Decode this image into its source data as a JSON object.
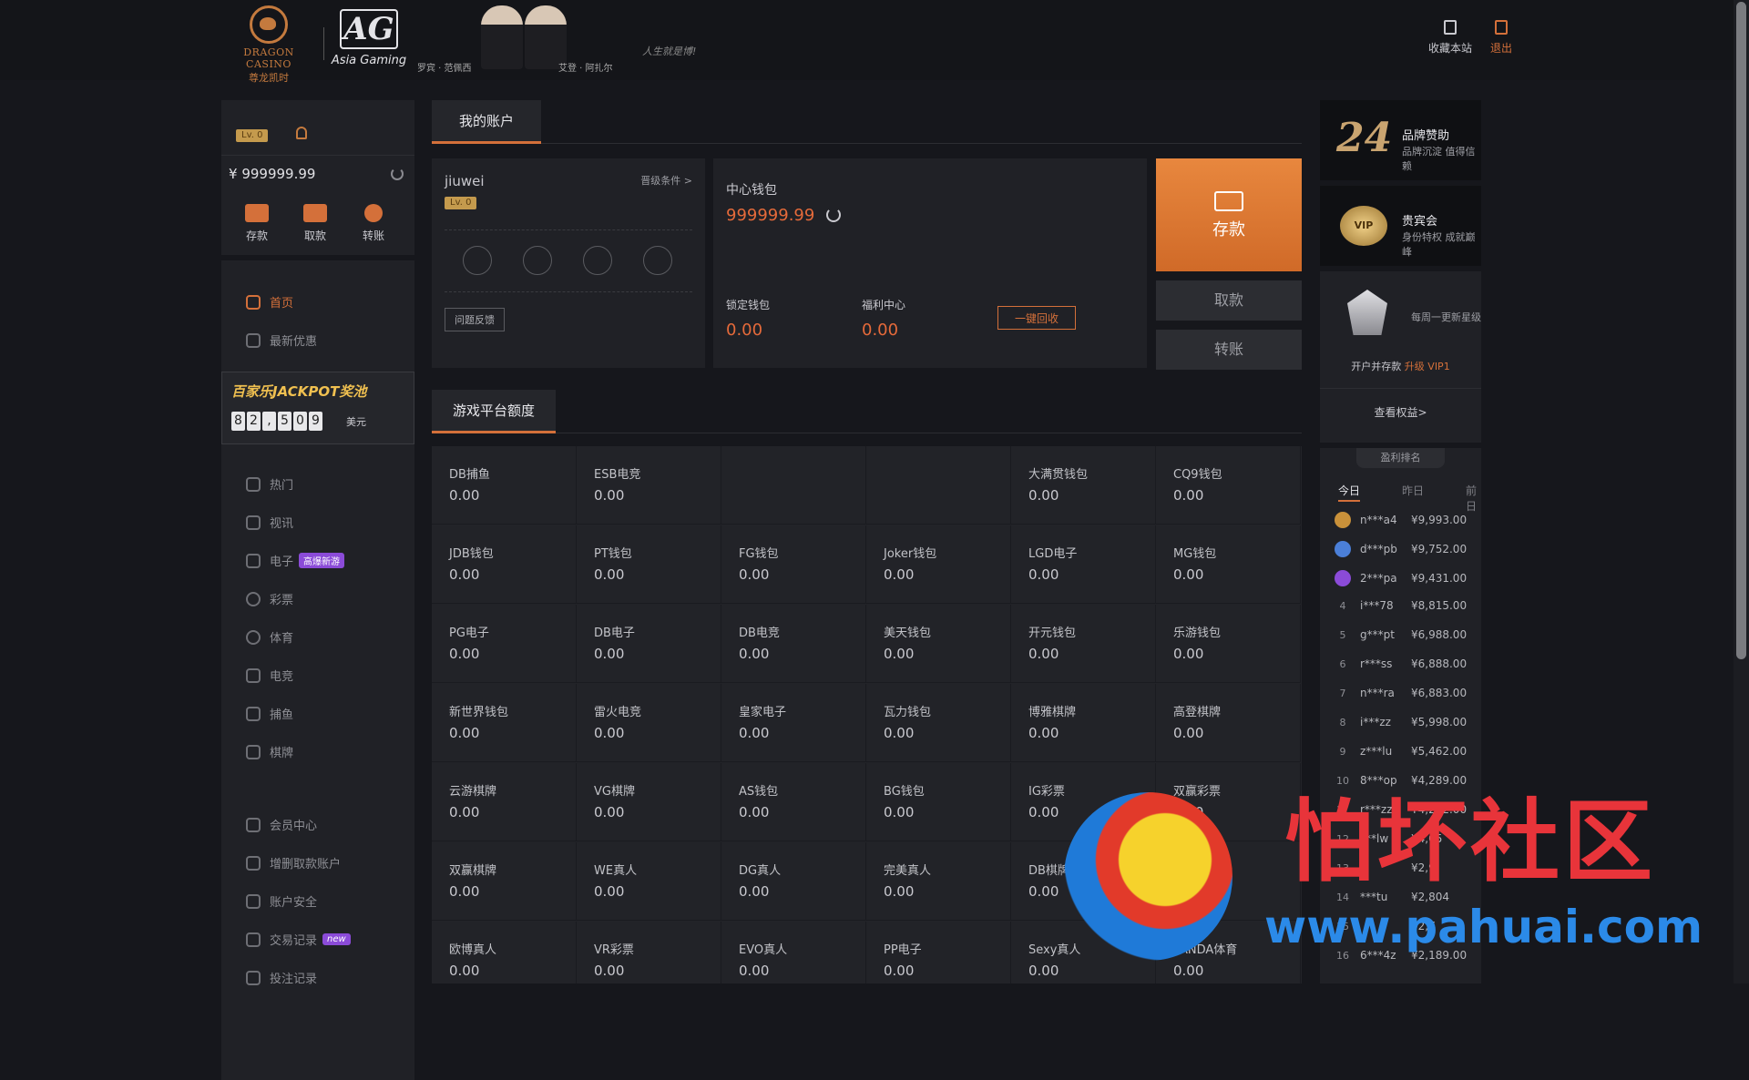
{
  "header": {
    "logo": {
      "en": "DRAGON CASINO",
      "cn": "尊龙凯时"
    },
    "partner": {
      "big": "AG",
      "small": "Asia Gaming"
    },
    "ambassadors": [
      "罗宾 · 范佩西",
      "艾登 · 阿扎尔"
    ],
    "slogan": "人生就是博!",
    "bookmark_label": "收藏本站",
    "logout_label": "退出"
  },
  "sidebar": {
    "level": "Lv. 0",
    "balance": "999999.99",
    "actions": [
      {
        "label": "存款"
      },
      {
        "label": "取款"
      },
      {
        "label": "转账"
      }
    ],
    "main_nav": [
      {
        "label": "首页"
      },
      {
        "label": "最新优惠"
      }
    ],
    "jackpot": {
      "title": "百家乐JACKPOT奖池",
      "digits": [
        "8",
        "2",
        ",",
        "5",
        "0",
        "9"
      ],
      "unit": "美元"
    },
    "game_nav": [
      {
        "label": "热门"
      },
      {
        "label": "视讯"
      },
      {
        "label": "电子",
        "badge": "高爆新游"
      },
      {
        "label": "彩票"
      },
      {
        "label": "体育"
      },
      {
        "label": "电竞"
      },
      {
        "label": "捕鱼"
      },
      {
        "label": "棋牌"
      }
    ],
    "account_nav": [
      {
        "label": "会员中心"
      },
      {
        "label": "增删取款账户"
      },
      {
        "label": "账户安全"
      },
      {
        "label": "交易记录",
        "badge": "new"
      },
      {
        "label": "投注记录"
      }
    ]
  },
  "account": {
    "tab_label": "我的账户",
    "username": "jiuwei",
    "level": "Lv. 0",
    "upgrade_link": "晋级条件 >",
    "feedback_label": "问题反馈"
  },
  "wallet": {
    "center_label": "中心钱包",
    "center_amount": "999999.99",
    "locked_label": "锁定钱包",
    "locked_amount": "0.00",
    "welfare_label": "福利中心",
    "welfare_amount": "0.00",
    "recall_label": "一键回收"
  },
  "buttons": {
    "deposit": "存款",
    "withdraw": "取款",
    "transfer": "转账"
  },
  "platforms": {
    "tab_label": "游戏平台额度",
    "items": [
      {
        "name": "DB捕鱼",
        "value": "0.00"
      },
      {
        "name": "ESB电竞",
        "value": "0.00"
      },
      {
        "name": "",
        "value": ""
      },
      {
        "name": "",
        "value": ""
      },
      {
        "name": "大满贯钱包",
        "value": "0.00"
      },
      {
        "name": "CQ9钱包",
        "value": "0.00"
      },
      {
        "name": "JDB钱包",
        "value": "0.00"
      },
      {
        "name": "PT钱包",
        "value": "0.00"
      },
      {
        "name": "FG钱包",
        "value": "0.00"
      },
      {
        "name": "Joker钱包",
        "value": "0.00"
      },
      {
        "name": "LGD电子",
        "value": "0.00"
      },
      {
        "name": "MG钱包",
        "value": "0.00"
      },
      {
        "name": "PG电子",
        "value": "0.00"
      },
      {
        "name": "DB电子",
        "value": "0.00"
      },
      {
        "name": "DB电竞",
        "value": "0.00"
      },
      {
        "name": "美天钱包",
        "value": "0.00"
      },
      {
        "name": "开元钱包",
        "value": "0.00"
      },
      {
        "name": "乐游钱包",
        "value": "0.00"
      },
      {
        "name": "新世界钱包",
        "value": "0.00"
      },
      {
        "name": "雷火电竞",
        "value": "0.00"
      },
      {
        "name": "皇家电子",
        "value": "0.00"
      },
      {
        "name": "瓦力钱包",
        "value": "0.00"
      },
      {
        "name": "博雅棋牌",
        "value": "0.00"
      },
      {
        "name": "高登棋牌",
        "value": "0.00"
      },
      {
        "name": "云游棋牌",
        "value": "0.00"
      },
      {
        "name": "VG棋牌",
        "value": "0.00"
      },
      {
        "name": "AS钱包",
        "value": "0.00"
      },
      {
        "name": "BG钱包",
        "value": "0.00"
      },
      {
        "name": "IG彩票",
        "value": "0.00"
      },
      {
        "name": "双赢彩票",
        "value": "0.00"
      },
      {
        "name": "双赢棋牌",
        "value": "0.00"
      },
      {
        "name": "WE真人",
        "value": "0.00"
      },
      {
        "name": "DG真人",
        "value": "0.00"
      },
      {
        "name": "完美真人",
        "value": "0.00"
      },
      {
        "name": "DB棋牌",
        "value": "0.00"
      },
      {
        "name": "",
        "value": ""
      },
      {
        "name": "欧博真人",
        "value": "0.00"
      },
      {
        "name": "VR彩票",
        "value": "0.00"
      },
      {
        "name": "EVO真人",
        "value": "0.00"
      },
      {
        "name": "PP电子",
        "value": "0.00"
      },
      {
        "name": "Sexy真人",
        "value": "0.00"
      },
      {
        "name": "PANDA体育",
        "value": "0.00"
      }
    ]
  },
  "promos": [
    {
      "badge": "24",
      "title": "品牌赞助",
      "subtitle": "品牌沉淀 值得信赖"
    },
    {
      "badge": "VIP",
      "title": "贵宾会",
      "subtitle": "身份特权 成就巅峰"
    }
  ],
  "vip_card": {
    "weekly": "每周一更新星级",
    "open_text": "开户并存款",
    "upgrade": "升级 VIP1",
    "view_link": "查看权益>"
  },
  "ranking": {
    "title": "盈利排名",
    "tabs": [
      "今日",
      "昨日",
      "前日"
    ],
    "rows": [
      {
        "rank": "1",
        "user": "n***a4",
        "amount": "¥9,993.00"
      },
      {
        "rank": "2",
        "user": "d***pb",
        "amount": "¥9,752.00"
      },
      {
        "rank": "3",
        "user": "2***pa",
        "amount": "¥9,431.00"
      },
      {
        "rank": "4",
        "user": "i***78",
        "amount": "¥8,815.00"
      },
      {
        "rank": "5",
        "user": "g***pt",
        "amount": "¥6,988.00"
      },
      {
        "rank": "6",
        "user": "r***ss",
        "amount": "¥6,888.00"
      },
      {
        "rank": "7",
        "user": "n***ra",
        "amount": "¥6,883.00"
      },
      {
        "rank": "8",
        "user": "i***zz",
        "amount": "¥5,998.00"
      },
      {
        "rank": "9",
        "user": "z***lu",
        "amount": "¥5,462.00"
      },
      {
        "rank": "10",
        "user": "8***op",
        "amount": "¥4,289.00"
      },
      {
        "rank": "11",
        "user": "r***zz",
        "amount": "¥4,232.00"
      },
      {
        "rank": "12",
        "user": "***lw",
        "amount": "¥4,05"
      },
      {
        "rank": "13",
        "user": "",
        "amount": "¥2,9"
      },
      {
        "rank": "14",
        "user": "***tu",
        "amount": "¥2,804"
      },
      {
        "rank": "15",
        "user": "",
        "amount": "¥2,7"
      },
      {
        "rank": "16",
        "user": "6***4z",
        "amount": "¥2,189.00"
      }
    ]
  },
  "watermark": {
    "cn": "怕坏社区",
    "url": "www.pahuai.com"
  },
  "colors": {
    "accent": "#d4703a",
    "bg": "#16171c",
    "panel": "#202126",
    "gold": "#c49a4d"
  }
}
